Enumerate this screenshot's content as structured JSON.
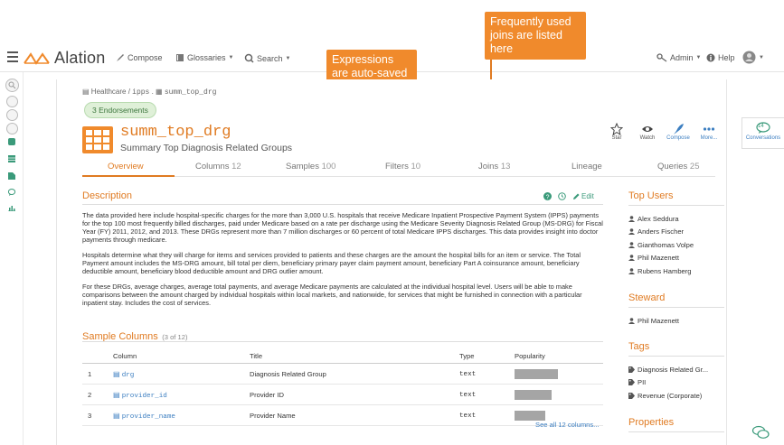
{
  "nav": {
    "brand": "Alation",
    "compose": "Compose",
    "glossaries": "Glossaries",
    "search": "Search",
    "admin": "Admin",
    "help": "Help"
  },
  "callouts": {
    "filters": "Expressions are auto-saved in the Filters tab",
    "joins": "Frequently used joins are listed here"
  },
  "rail": {
    "badge": "3"
  },
  "breadcrumb": {
    "db": "Healthcare",
    "schema": "ipps",
    "table": "summ_top_drg"
  },
  "endorsements": "3 Endorsements",
  "object": {
    "title": "summ_top_drg",
    "subtitle": "Summary Top Diagnosis Related Groups"
  },
  "actions": {
    "star": "Star",
    "watch": "Watch",
    "compose": "Compose",
    "more": "More..."
  },
  "tabs": [
    {
      "label": "Overview",
      "count": ""
    },
    {
      "label": "Columns",
      "count": "12"
    },
    {
      "label": "Samples",
      "count": "100"
    },
    {
      "label": "Filters",
      "count": "10"
    },
    {
      "label": "Joins",
      "count": "13"
    },
    {
      "label": "Lineage",
      "count": ""
    },
    {
      "label": "Queries",
      "count": "25"
    }
  ],
  "description": {
    "title": "Description",
    "edit": "Edit",
    "p1": "The data provided here include hospital-specific charges for the more than 3,000 U.S. hospitals that receive Medicare Inpatient Prospective Payment System (IPPS) payments for the top 100 most frequently billed discharges, paid under Medicare based on a rate per discharge using the Medicare Severity Diagnosis Related Group (MS-DRG) for Fiscal Year (FY) 2011, 2012, and 2013. These DRGs represent more than 7 million discharges or 60 percent of total Medicare IPPS discharges. This data provides insight into doctor payments through medicare.",
    "p2": "Hospitals determine what they will charge for items and services provided to patients and these charges are the amount the hospital bills for an item or service. The Total Payment amount includes the MS-DRG amount, bill total per diem, beneficiary primary payer claim payment amount, beneficiary Part A coinsurance amount, beneficiary deductible amount, beneficiary blood deductible amount and DRG outlier amount.",
    "p3": "For these DRGs, average charges, average total payments, and average Medicare payments are calculated at the individual hospital level. Users will be able to make comparisons between the amount charged by individual hospitals within local markets, and nationwide, for services that might be furnished in connection with a particular inpatient stay. Includes the cost of services."
  },
  "sample_columns": {
    "title": "Sample Columns",
    "count": "(3 of 12)",
    "headers": [
      "Column",
      "Title",
      "Type",
      "Popularity"
    ],
    "rows": [
      {
        "n": "1",
        "col": "drg",
        "title": "Diagnosis Related Group",
        "type": "text",
        "popularity": 0.85
      },
      {
        "n": "2",
        "col": "provider_id",
        "title": "Provider ID",
        "type": "text",
        "popularity": 0.73
      },
      {
        "n": "3",
        "col": "provider_name",
        "title": "Provider Name",
        "type": "text",
        "popularity": 0.6
      }
    ],
    "see_all": "See all 12 columns..."
  },
  "sidebar": {
    "top_users_title": "Top Users",
    "top_users": [
      "Alex Seddura",
      "Anders Fischer",
      "Gianthomas Volpe",
      "Phil Mazenett",
      "Rubens Hamberg"
    ],
    "steward_title": "Steward",
    "steward": "Phil Mazenett",
    "tags_title": "Tags",
    "tags": [
      "Diagnosis Related Gr...",
      "PII",
      "Revenue (Corporate)"
    ],
    "properties_title": "Properties"
  },
  "conversations": {
    "count": "14",
    "label": "Conversations"
  },
  "colors": {
    "accent": "#e07b22",
    "link": "#3d7fc1"
  }
}
